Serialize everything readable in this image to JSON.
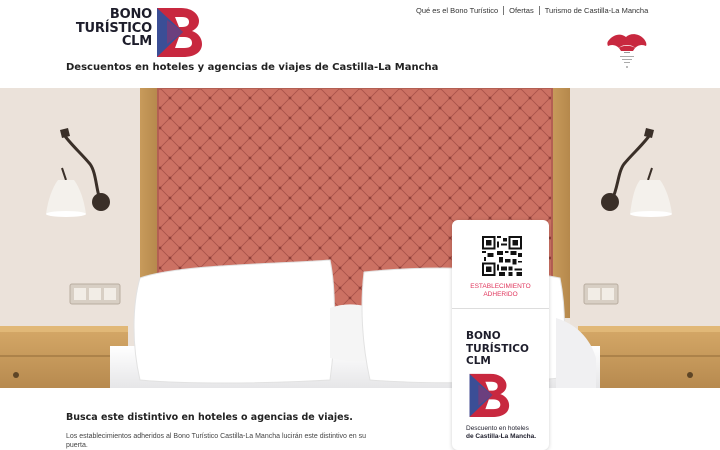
{
  "header": {
    "logo_text_line1": "BONO",
    "logo_text_line2": "TURÍSTICO",
    "logo_text_line3": "CLM",
    "tagline": "Descuentos en hoteles y agencias de viajes de Castilla-La Mancha",
    "nav": [
      {
        "label": "Qué es el Bono Turístico"
      },
      {
        "label": "Ofertas"
      },
      {
        "label": "Turismo de Castilla-La Mancha"
      }
    ]
  },
  "badge": {
    "adhered_line1": "ESTABLECIMIENTO",
    "adhered_line2": "ADHERIDO",
    "title_line1": "BONO",
    "title_line2": "TURÍSTICO",
    "title_line3": "CLM",
    "footer_line1": "Descuento en hoteles",
    "footer_line2": "de Castilla-La Mancha."
  },
  "main": {
    "title": "Busca este distintivo en hoteles o agencias de viajes.",
    "description": "Los establecimientos adheridos al Bono Turístico Castilla-La Mancha lucirán este distintivo en su puerta."
  },
  "colors": {
    "brand_dark": "#1d1d2b",
    "brand_red": "#c8283f",
    "brand_blue": "#3b4e96",
    "brand_purple": "#6c3f7e",
    "accent_pink": "#e0355c",
    "headboard": "#c96b5d"
  },
  "icons": {
    "logo": "bono-turistico-b-logo-icon",
    "region": "castilla-la-mancha-logo-icon",
    "qr": "qr-code-icon"
  }
}
